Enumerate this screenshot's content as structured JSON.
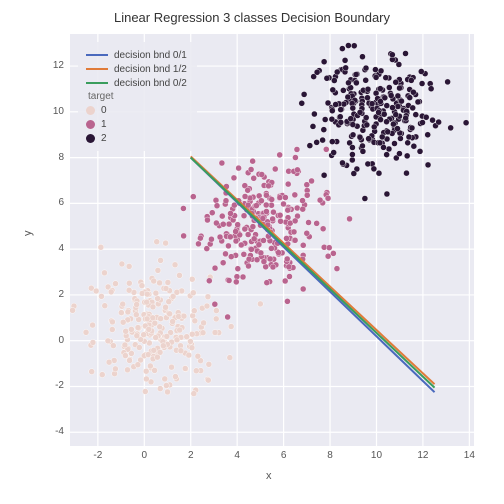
{
  "chart_data": {
    "type": "scatter",
    "title": "Linear Regression 3 classes Decision Boundary",
    "xlabel": "x",
    "ylabel": "y",
    "xlim": [
      -3.2,
      14.2
    ],
    "ylim": [
      -4.6,
      13.4
    ],
    "xticks": [
      -2,
      0,
      2,
      4,
      6,
      8,
      10,
      12,
      14
    ],
    "yticks": [
      -4,
      -2,
      0,
      2,
      4,
      6,
      8,
      10,
      12
    ],
    "hue_title": "target",
    "clusters": [
      {
        "label": "0",
        "color": "#ecd3cd",
        "cx": 0.5,
        "cy": 0.5,
        "sd": 1.3,
        "n": 250
      },
      {
        "label": "1",
        "color": "#b9648f",
        "cx": 5.0,
        "cy": 5.0,
        "sd": 1.3,
        "n": 260
      },
      {
        "label": "2",
        "color": "#2a1636",
        "cx": 10.0,
        "cy": 10.0,
        "sd": 1.3,
        "n": 270
      }
    ],
    "lines": [
      {
        "name": "decision bnd 0/1",
        "color": "#4a69bd",
        "x0": 2.0,
        "y0": 8.0,
        "x1": 12.5,
        "y1": -2.25
      },
      {
        "name": "decision bnd 1/2",
        "color": "#e07b39",
        "x0": 2.0,
        "y0": 8.05,
        "x1": 12.5,
        "y1": -1.9
      },
      {
        "name": "decision bnd 0/2",
        "color": "#3a9d5d",
        "x0": 2.0,
        "y0": 8.0,
        "x1": 12.5,
        "y1": -2.05
      }
    ]
  }
}
